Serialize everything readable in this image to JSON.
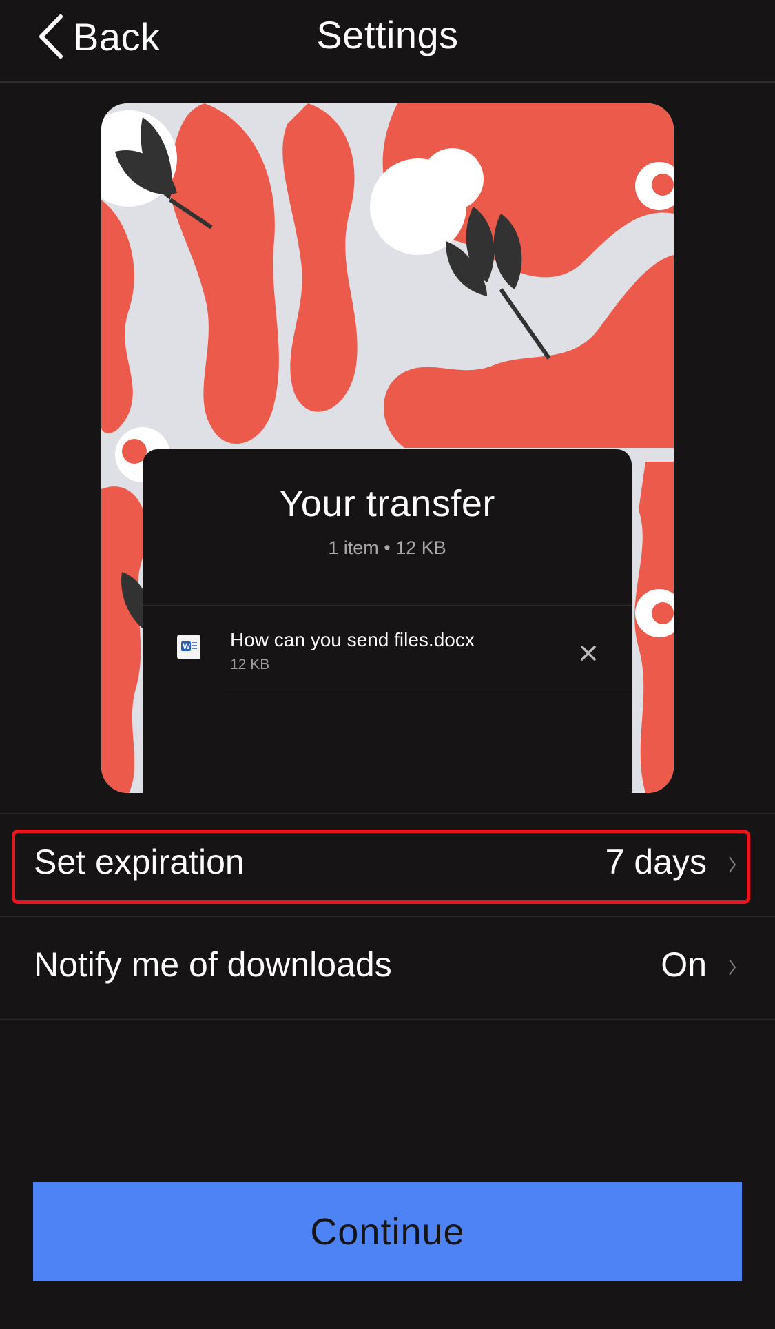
{
  "header": {
    "back_label": "Back",
    "title": "Settings"
  },
  "transfer": {
    "title": "Your transfer",
    "meta": "1 item • 12 KB",
    "files": [
      {
        "name": "How can you send files.docx",
        "size": "12 KB",
        "type_icon": "word-doc-icon"
      }
    ]
  },
  "settings": [
    {
      "label": "Set expiration",
      "value": "7 days"
    },
    {
      "label": "Notify me of downloads",
      "value": "On"
    }
  ],
  "continue_label": "Continue",
  "colors": {
    "background": "#161415",
    "accent": "#4e83f5",
    "highlight": "#e7151d",
    "artwork_red": "#ec5a4b",
    "artwork_bg": "#dfe0e5"
  }
}
